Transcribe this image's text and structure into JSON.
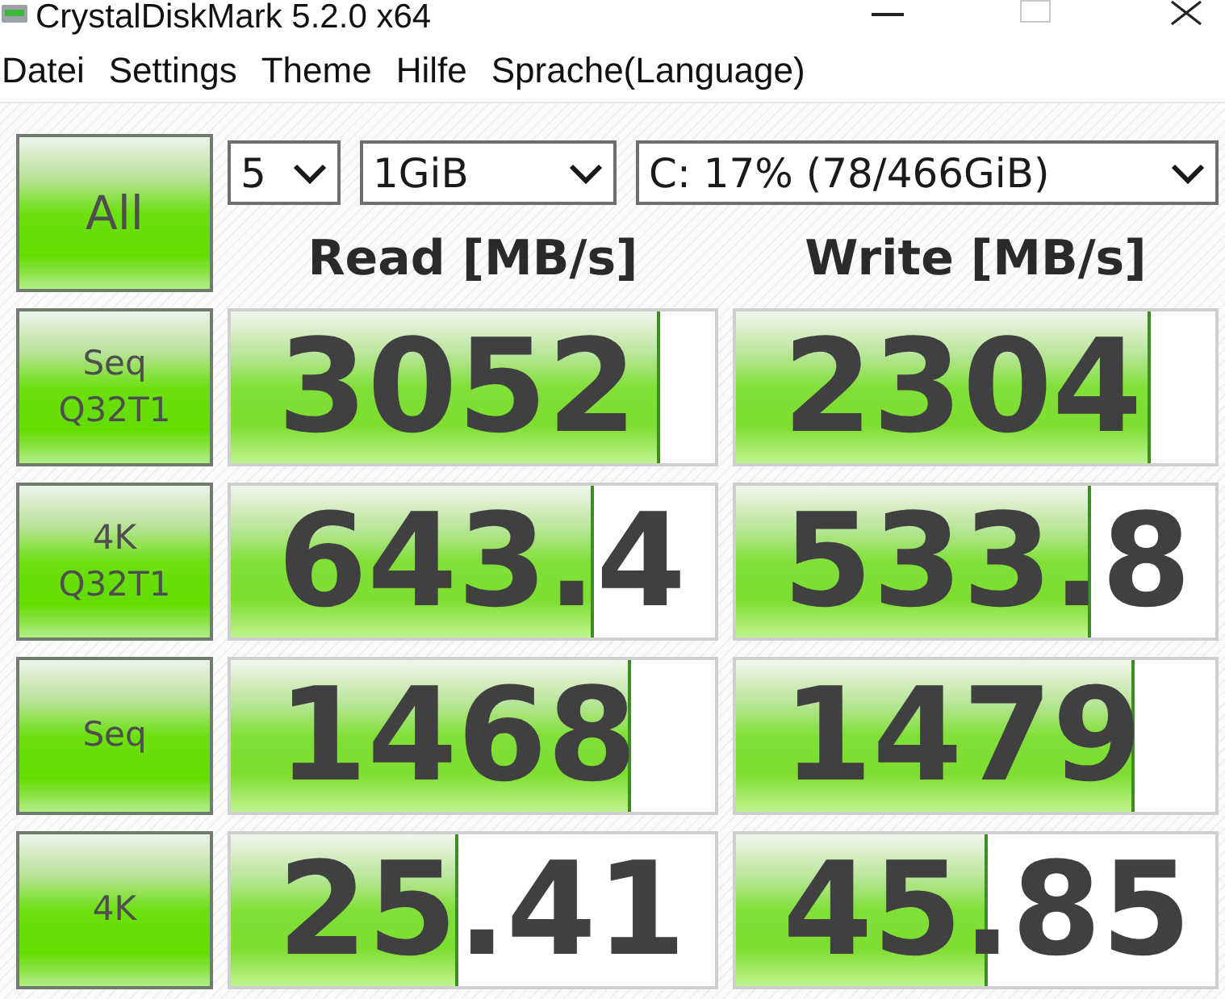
{
  "window": {
    "title": "CrystalDiskMark 5.2.0 x64"
  },
  "menu": [
    "Datei",
    "Settings",
    "Theme",
    "Hilfe",
    "Sprache(Language)"
  ],
  "all_button": {
    "label": "All"
  },
  "selectors": [
    {
      "kind": "short",
      "value": "5"
    },
    {
      "kind": "medium",
      "value": "1GiB"
    },
    {
      "kind": "long",
      "value": "C: 17% (78/466GiB)"
    }
  ],
  "columns": [
    "Read [MB/s]",
    "Write [MB/s]"
  ],
  "tests": [
    {
      "label": "Seq\nQ32T1",
      "results": [
        {
          "value": "3052",
          "level": 0.885
        },
        {
          "value": "2304",
          "level": 0.864
        }
      ]
    },
    {
      "label": "4K\nQ32T1",
      "results": [
        {
          "value": "643.4",
          "level": 0.75
        },
        {
          "value": "533.8",
          "level": 0.74
        }
      ]
    },
    {
      "label": "Seq",
      "results": [
        {
          "value": "1468",
          "level": 0.825
        },
        {
          "value": "1479",
          "level": 0.83
        }
      ]
    },
    {
      "label": "4K",
      "results": [
        {
          "value": "25.41",
          "level": 0.47
        },
        {
          "value": "45.85",
          "level": 0.525
        }
      ]
    }
  ]
}
